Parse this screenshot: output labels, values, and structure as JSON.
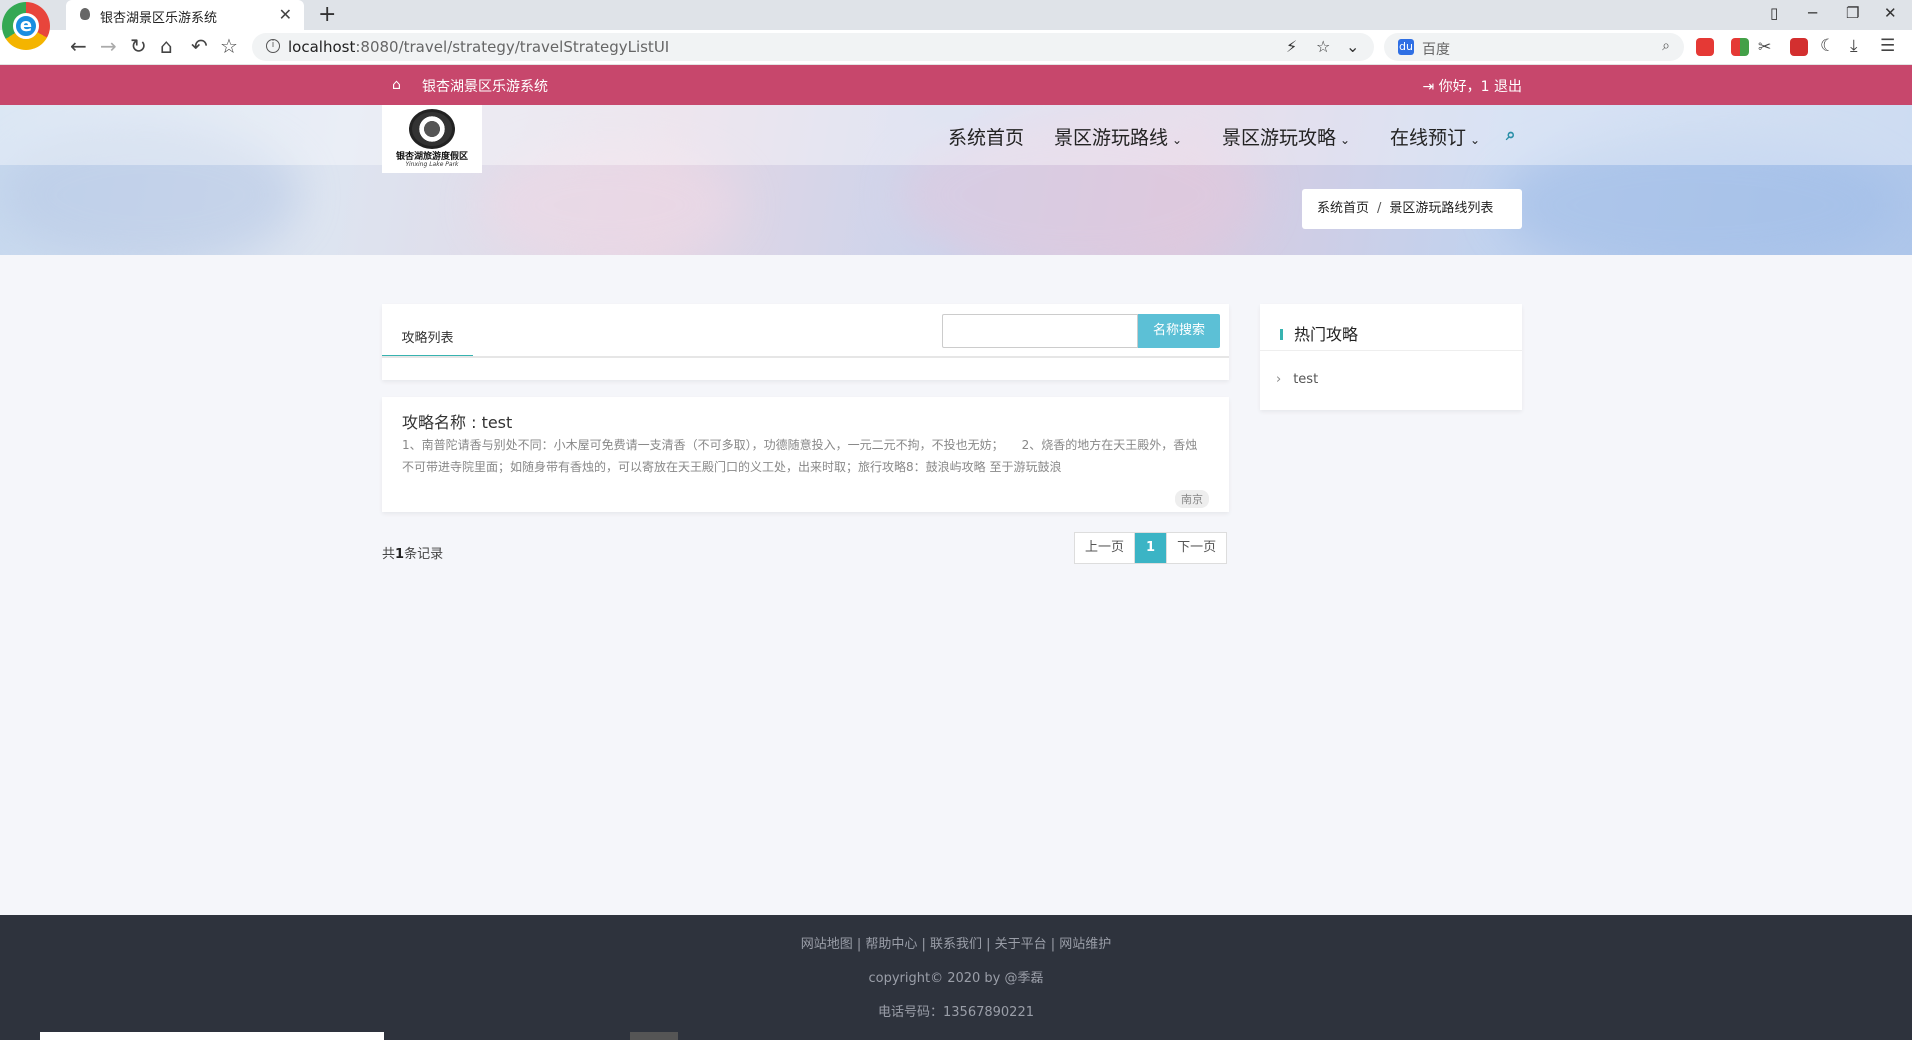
{
  "browser": {
    "tab_title": "银杏湖景区乐游系统",
    "tab_close": "✕",
    "new_tab": "+",
    "url_host": "localhost",
    "url_path": ":8080/travel/strategy/travelStrategyListUI",
    "search_placeholder": "百度"
  },
  "topbar": {
    "site_name": "银杏湖景区乐游系统",
    "greeting": "你好，1",
    "logout": "退出"
  },
  "logo": {
    "name": "银杏湖旅游度假区",
    "subtitle": "Yinxing Lake Park"
  },
  "nav": {
    "items": [
      {
        "label": "系统首页",
        "has_dropdown": false
      },
      {
        "label": "景区游玩路线",
        "has_dropdown": true
      },
      {
        "label": "景区游玩攻略",
        "has_dropdown": true
      },
      {
        "label": "在线预订",
        "has_dropdown": true
      }
    ]
  },
  "breadcrumb": {
    "home": "系统首页",
    "separator": "/",
    "current": "景区游玩路线列表"
  },
  "list": {
    "tab_label": "攻略列表",
    "search_value": "",
    "search_button": "名称搜索",
    "items": [
      {
        "title": "攻略名称 : test",
        "description": "1、南普陀请香与别处不同：小木屋可免费请一支清香（不可多取），功德随意投入，一元二元不拘，不投也无妨；　　2、烧香的地方在天王殿外，香烛不可带进寺院里面；如随身带有香烛的，可以寄放在天王殿门口的义工处，出来时取；旅行攻略8：鼓浪屿攻略 至于游玩鼓浪",
        "tag": "南京"
      }
    ]
  },
  "pagination": {
    "count_prefix": "共",
    "count": "1",
    "count_suffix": "条记录",
    "prev": "上一页",
    "current": "1",
    "next": "下一页"
  },
  "sidebar": {
    "title": "热门攻略",
    "items": [
      {
        "label": "test"
      }
    ]
  },
  "footer": {
    "links": "网站地图 | 帮助中心 | 联系我们 | 关于平台 | 网站维护",
    "copyright": "copyright© 2020 by @季磊",
    "phone": "电话号码：13567890221"
  },
  "colors": {
    "topbar": "#c7476c",
    "accent": "#37b3b0",
    "search_button": "#5cc0d6",
    "pager_active": "#3bb4c5",
    "footer": "#2e333d"
  }
}
